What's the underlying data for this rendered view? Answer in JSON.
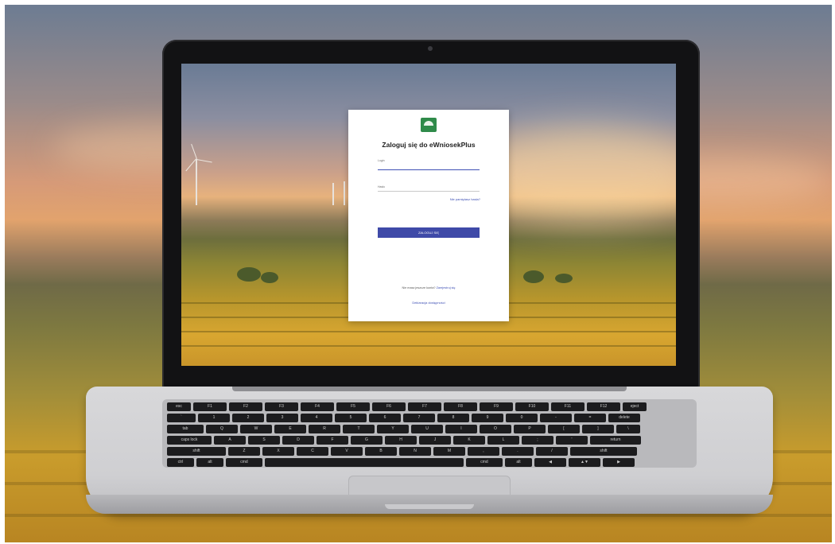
{
  "login": {
    "title": "Zaloguj się do eWniosekPlus",
    "login_label": "Login",
    "password_label": "Hasło",
    "forgot_password": "Nie pamiętasz hasła?",
    "submit_label": "ZALOGUJ SIĘ",
    "register_prompt": "Nie masz jeszcze konta?",
    "register_link": "Zarejestruj się",
    "accessibility_link": "Deklaracja dostępności"
  },
  "keyboard": {
    "row1": [
      "esc",
      "F1",
      "F2",
      "F3",
      "F4",
      "F5",
      "F6",
      "F7",
      "F8",
      "F9",
      "F10",
      "F11",
      "F12",
      "eject"
    ],
    "row2": [
      "`",
      "1",
      "2",
      "3",
      "4",
      "5",
      "6",
      "7",
      "8",
      "9",
      "0",
      "-",
      "=",
      "delete"
    ],
    "row3": [
      "tab",
      "Q",
      "W",
      "E",
      "R",
      "T",
      "Y",
      "U",
      "I",
      "O",
      "P",
      "[",
      "]",
      "\\"
    ],
    "row4": [
      "caps lock",
      "A",
      "S",
      "D",
      "F",
      "G",
      "H",
      "J",
      "K",
      "L",
      ";",
      "'",
      "return"
    ],
    "row5": [
      "shift",
      "Z",
      "X",
      "C",
      "V",
      "B",
      "N",
      "M",
      ",",
      ".",
      "/",
      "shift"
    ],
    "row6": [
      "ctrl",
      "alt",
      "cmd",
      "",
      "cmd",
      "alt",
      "◀",
      "▲▼",
      "▶"
    ]
  },
  "colors": {
    "primary": "#3f4aa8",
    "link": "#3f51b5",
    "logo_green": "#2f8b4a"
  }
}
